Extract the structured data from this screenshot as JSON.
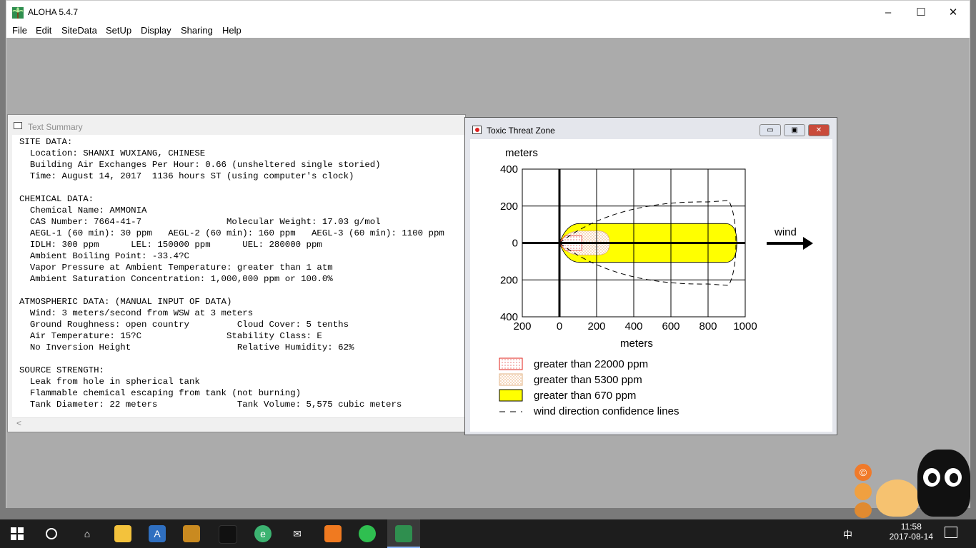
{
  "app": {
    "title": "ALOHA 5.4.7",
    "controls": {
      "minimize": "–",
      "maximize": "☐",
      "close": "✕"
    }
  },
  "menu": [
    "File",
    "Edit",
    "SiteData",
    "SetUp",
    "Display",
    "Sharing",
    "Help"
  ],
  "text_summary": {
    "title": "Text Summary",
    "lines": [
      "SITE DATA:",
      "  Location: SHANXI WUXIANG, CHINESE",
      "  Building Air Exchanges Per Hour: 0.66 (unsheltered single storied)",
      "  Time: August 14, 2017  1136 hours ST (using computer's clock)",
      "",
      "CHEMICAL DATA:",
      "  Chemical Name: AMMONIA",
      "  CAS Number: 7664-41-7                Molecular Weight: 17.03 g/mol",
      "  AEGL-1 (60 min): 30 ppm   AEGL-2 (60 min): 160 ppm   AEGL-3 (60 min): 1100 ppm",
      "  IDLH: 300 ppm      LEL: 150000 ppm      UEL: 280000 ppm",
      "  Ambient Boiling Point: -33.4?C",
      "  Vapor Pressure at Ambient Temperature: greater than 1 atm",
      "  Ambient Saturation Concentration: 1,000,000 ppm or 100.0%",
      "",
      "ATMOSPHERIC DATA: (MANUAL INPUT OF DATA)",
      "  Wind: 3 meters/second from WSW at 3 meters",
      "  Ground Roughness: open country         Cloud Cover: 5 tenths",
      "  Air Temperature: 15?C                Stability Class: E",
      "  No Inversion Height                    Relative Humidity: 62%",
      "",
      "SOURCE STRENGTH:",
      "  Leak from hole in spherical tank",
      "  Flammable chemical escaping from tank (not burning)",
      "  Tank Diameter: 22 meters               Tank Volume: 5,575 cubic meters"
    ],
    "scroll_left": "<"
  },
  "threat_zone": {
    "title": "Toxic Threat Zone",
    "controls": {
      "minimize": "▭",
      "restore": "▣",
      "close": "✕"
    },
    "wind_label": "wind",
    "colors": {
      "red_zone": "#e0201a",
      "orange_zone": "#f5d6a0",
      "yellow_zone": "#ffff00"
    },
    "chart_data": {
      "type": "area",
      "ylabel": "meters",
      "xlabel": "meters",
      "x_ticks": [
        "200",
        "0",
        "200",
        "400",
        "600",
        "800",
        "1000"
      ],
      "y_ticks": [
        "400",
        "200",
        "0",
        "200",
        "400"
      ],
      "xlim": [
        -200,
        1000
      ],
      "ylim": [
        -400,
        400
      ],
      "grid": true,
      "zones": [
        {
          "name": "greater than 22000 ppm",
          "x_extent": [
            0,
            120
          ],
          "half_width": 40
        },
        {
          "name": "greater than 5300 ppm",
          "x_extent": [
            0,
            270
          ],
          "half_width": 65
        },
        {
          "name": "greater than 670 ppm",
          "x_extent": [
            0,
            955
          ],
          "half_width": 105
        }
      ],
      "confidence_lines": {
        "name": "wind direction confidence lines",
        "x_extent": [
          0,
          950
        ],
        "half_width": 230
      }
    },
    "legend": [
      {
        "label": "greater than 22000 ppm",
        "swatch": "red"
      },
      {
        "label": "greater than 5300 ppm",
        "swatch": "orange"
      },
      {
        "label": "greater than 670 ppm",
        "swatch": "yellow"
      },
      {
        "label": "wind direction confidence lines",
        "swatch": "dashed"
      }
    ]
  },
  "taskbar": {
    "time": "11:58",
    "date": "2017-08-14",
    "ime": "中",
    "icons": [
      "windows-start-icon",
      "cortana-icon",
      "home-icon",
      "file-explorer-icon",
      "app-store-icon",
      "cat-app-icon",
      "qq-icon",
      "browser-icon",
      "mail-icon",
      "pdf-icon",
      "wechat-icon",
      "aloha-icon"
    ]
  }
}
